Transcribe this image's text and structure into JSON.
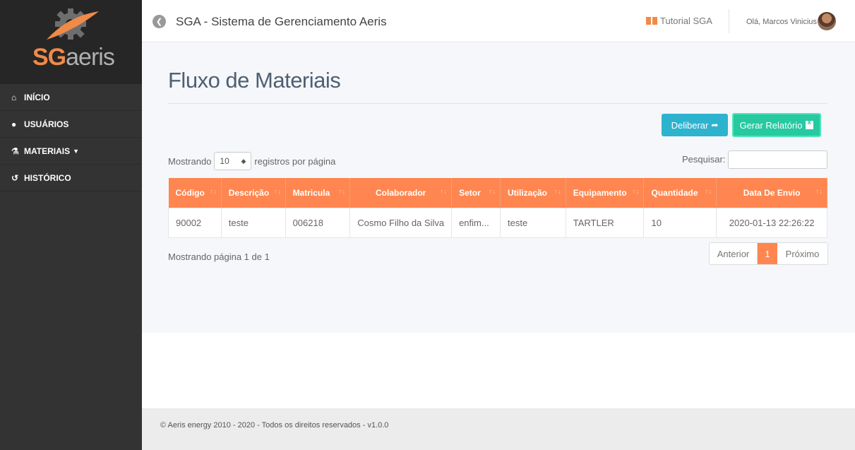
{
  "brand": {
    "logo_sg": "SG",
    "logo_rest": "aeris"
  },
  "sidebar": {
    "items": [
      {
        "label": "INÍCIO",
        "icon": "home-icon"
      },
      {
        "label": "USUÁRIOS",
        "icon": "user-icon"
      },
      {
        "label": "MATERIAIS",
        "icon": "materials-icon"
      },
      {
        "label": "HISTÓRICO",
        "icon": "history-icon"
      }
    ]
  },
  "header": {
    "title": "SGA - Sistema de Gerenciamento Aeris",
    "tutorial_label": "Tutorial SGA",
    "greeting": "Olá, Marcos Vinicius"
  },
  "main": {
    "page_title": "Fluxo de Materiais",
    "deliberar_label": "Deliberar",
    "relatorio_label": "Gerar Relatório",
    "length_prefix": "Mostrando",
    "length_value": "10",
    "length_suffix": "registros por página",
    "search_label": "Pesquisar:",
    "search_value": "",
    "table": {
      "headers": [
        "Código",
        "Descrição",
        "Matricula",
        "Colaborador",
        "Setor",
        "Utilização",
        "Equipamento",
        "Quantidade",
        "Data De Envio"
      ],
      "rows": [
        [
          "90002",
          "teste",
          "006218",
          "Cosmo Filho da Silva",
          "enfim...",
          "teste",
          "TARTLER",
          "10",
          "2020-01-13 22:26:22"
        ]
      ]
    },
    "info": "Mostrando página 1 de 1",
    "pagination": {
      "prev": "Anterior",
      "current": "1",
      "next": "Próximo"
    }
  },
  "footer": {
    "text": "© Aeris energy 2010 - 2020 - Todos os direitos reservados - v1.0.0"
  },
  "colors": {
    "accent": "#ff8650",
    "sidebar": "#333333",
    "deliberar": "#2eb3cf",
    "relatorio": "#26c9a0"
  }
}
